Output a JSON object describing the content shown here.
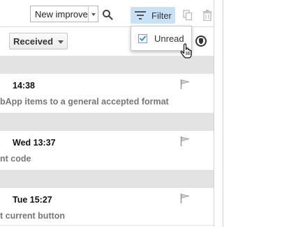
{
  "toolbar": {
    "search_value": "New improve",
    "filter_label": "Filter",
    "sort_label": "Received"
  },
  "filter_menu": {
    "unread_label": "Unread",
    "unread_checked": true
  },
  "messages": [
    {
      "time": "14:38",
      "subject": "bApp items to a general accepted format"
    },
    {
      "time": "Wed 13:37",
      "subject": "nt code"
    },
    {
      "time": "Tue 15:27",
      "subject": "t current button"
    }
  ],
  "colors": {
    "filter_active_bg": "#c7e2f7",
    "group_band": "#e3e3e3",
    "checkbox_check": "#2a8fd0"
  }
}
